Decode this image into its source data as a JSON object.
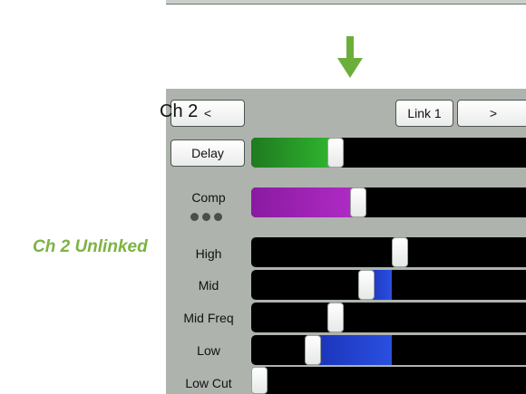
{
  "caption": "Ch 2 Unlinked",
  "header": {
    "prev_label": "<",
    "title": "Ch 2",
    "link_label": "Link 1",
    "next_label": ">"
  },
  "delay": {
    "button_label": "Delay",
    "level": 0.27
  },
  "comp": {
    "label": "Comp",
    "level": 0.35
  },
  "eq": [
    {
      "label": "High",
      "level": 0.5
    },
    {
      "label": "Mid",
      "level": 0.38
    },
    {
      "label": "Mid Freq",
      "level": 0.27
    },
    {
      "label": "Low",
      "level": 0.19
    },
    {
      "label": "Low Cut",
      "level": 0.0
    }
  ],
  "colors": {
    "caption": "#7cb342",
    "panel": "#aeb3ae",
    "delay_fill": "#2ba82b",
    "comp_fill": "#a21caf",
    "eq_fill": "#1f3fd0",
    "arrow": "#6cae3a"
  }
}
